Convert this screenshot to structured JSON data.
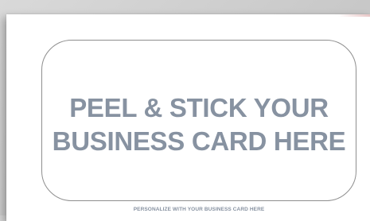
{
  "card": {
    "instruction_line1": "PEEL & STICK YOUR",
    "instruction_line2": "BUSINESS CARD HERE",
    "footer_caption": "PERSONALIZE WITH YOUR BUSINESS CARD HERE"
  },
  "colors": {
    "text": "#8792a1",
    "outline": "#8e8e8e",
    "sheet": "#ffffff"
  }
}
